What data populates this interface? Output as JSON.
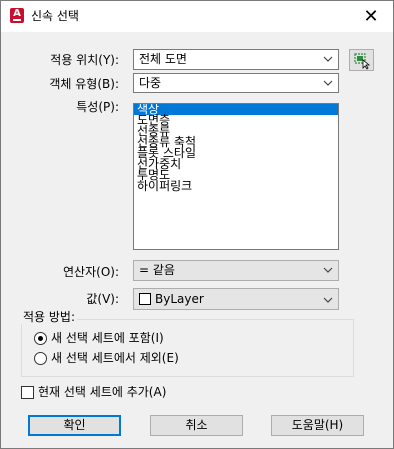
{
  "window": {
    "title": "신속 선택",
    "close_glyph": "✕"
  },
  "fields": {
    "apply_to": {
      "label": "적용 위치(Y):",
      "value": "전체 도면"
    },
    "object_type": {
      "label": "객체 유형(B):",
      "value": "다중"
    },
    "properties": {
      "label": "특성(P):",
      "items": [
        "색상",
        "도면층",
        "선종류",
        "선종류 축척",
        "플롯 스타일",
        "선가중치",
        "투명도",
        "하이퍼링크"
      ],
      "selected_index": 0
    },
    "operator": {
      "label": "연산자(O):",
      "value": "= 같음"
    },
    "value": {
      "label": "값(V):",
      "value": "ByLayer",
      "swatch_color": "#ffffff"
    }
  },
  "how_to_apply": {
    "legend": "적용 방법:",
    "options": [
      {
        "label": "새 선택 세트에 포함(I)",
        "selected": true
      },
      {
        "label": "새 선택 세트에서 제외(E)",
        "selected": false
      }
    ]
  },
  "append": {
    "label": "현재 선택 세트에 추가(A)",
    "checked": false
  },
  "buttons": {
    "ok": "확인",
    "cancel": "취소",
    "help": "도움말(H)"
  },
  "colors": {
    "accent": "#0078d7",
    "app_icon": "#c8102e",
    "select_icon": "#2e8b3d"
  }
}
